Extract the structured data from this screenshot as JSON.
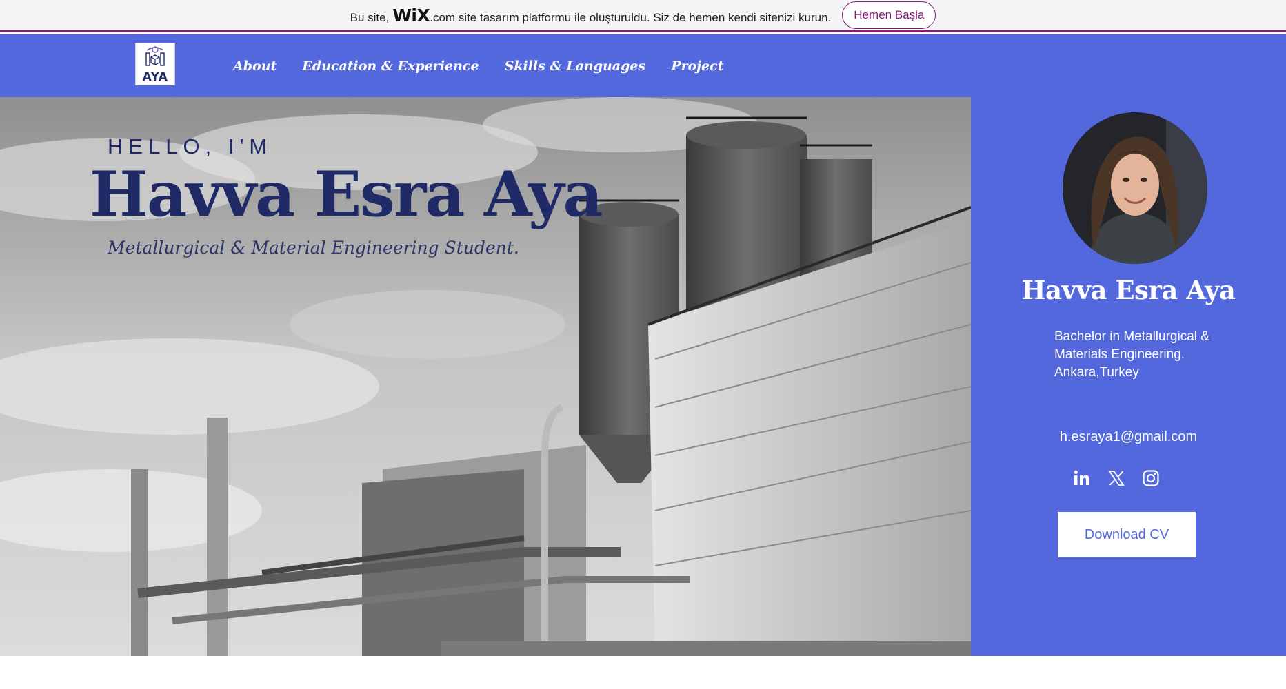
{
  "wix_banner": {
    "prefix": "Bu site,",
    "logo": "WiX",
    "suffix": ".com site tasarım platformu ile oluşturuldu. Siz de hemen kendi sitenizi kurun.",
    "button": "Hemen Başla",
    "accent": "#8a1a7a"
  },
  "header": {
    "logo_text": "AYA",
    "nav": [
      "About",
      "Education & Experience",
      "Skills & Languages",
      "Project"
    ],
    "background": "#5468de"
  },
  "hero": {
    "greeting": "HELLO, I'M",
    "name": "Havva Esra Aya",
    "subtitle": "Metallurgical & Material Engineering Student.",
    "text_color": "#1f2a66"
  },
  "profile": {
    "name": "Havva Esra Aya",
    "bio_line1": "Bachelor in Metallurgical &",
    "bio_line2": "Materials Engineering.",
    "bio_line3": "Ankara,Turkey",
    "email": "h.esraya1@gmail.com",
    "socials": [
      "linkedin-icon",
      "x-icon",
      "instagram-icon"
    ],
    "download_button": "Download CV"
  }
}
